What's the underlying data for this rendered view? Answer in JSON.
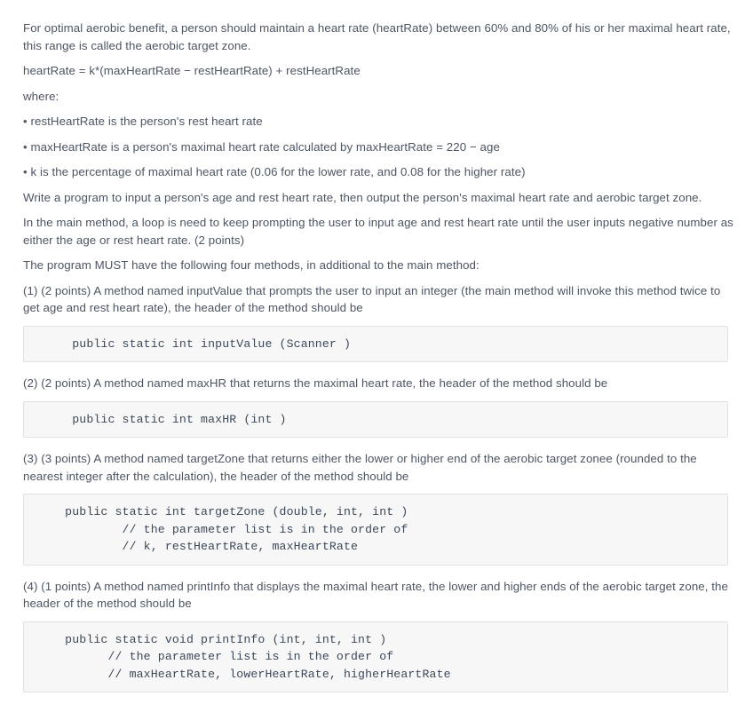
{
  "document": {
    "type": "programming-assignment-prompt",
    "colors": {
      "body_text": "#4d5562",
      "code_text": "#3c4858",
      "code_background": "#f7f7f7",
      "code_border": "#e2e2e2",
      "page_background": "#ffffff"
    },
    "blocks": [
      {
        "kind": "paragraph",
        "name": "intro-paragraph",
        "text": "For optimal aerobic benefit, a person should maintain a heart rate (heartRate) between 60% and 80% of his or her maximal heart rate, this range is called the aerobic target zone."
      },
      {
        "kind": "paragraph",
        "name": "formula-paragraph",
        "text": "heartRate = k*(maxHeartRate − restHeartRate) + restHeartRate"
      },
      {
        "kind": "paragraph",
        "name": "where-label",
        "text": "where:"
      },
      {
        "kind": "paragraph",
        "name": "bullet-rest-heart-rate",
        "text": "• restHeartRate is the person's rest heart rate"
      },
      {
        "kind": "paragraph",
        "name": "bullet-max-heart-rate",
        "text": "• maxHeartRate is a person's maximal heart rate calculated by maxHeartRate = 220 − age"
      },
      {
        "kind": "paragraph",
        "name": "bullet-k-percentage",
        "text": "• k is the percentage of maximal heart rate (0.06 for the lower rate, and 0.08 for the higher rate)"
      },
      {
        "kind": "paragraph",
        "name": "task-paragraph",
        "text": "Write a program to input a person's age and rest heart rate, then output the person's maximal heart rate and aerobic target zone."
      },
      {
        "kind": "paragraph",
        "name": "main-method-requirement",
        "text": "In the main method, a loop is need to keep prompting the user to input age and rest heart rate until the user inputs negative number as either the age or rest heart rate. (2 points)"
      },
      {
        "kind": "paragraph",
        "name": "four-methods-intro",
        "text": "The program MUST have the following four methods, in additional to the main method:"
      },
      {
        "kind": "paragraph",
        "name": "method-1-description",
        "text": "(1) (2 points) A method named inputValue that prompts the user to input an integer (the main method will invoke this method twice to get age and rest heart rate), the header of the method should be"
      },
      {
        "kind": "code",
        "name": "code-block-input-value",
        "text": "     public static int inputValue (Scanner )"
      },
      {
        "kind": "paragraph",
        "name": "method-2-description",
        "text": "(2) (2 points) A method named maxHR that returns the maximal heart rate, the header of the method should be"
      },
      {
        "kind": "code",
        "name": "code-block-max-hr",
        "text": "     public static int maxHR (int )"
      },
      {
        "kind": "paragraph",
        "name": "method-3-description",
        "text": "(3) (3 points) A method named targetZone that returns either the lower or higher end of the aerobic target zonee (rounded to the nearest integer after the calculation), the header of the method should be"
      },
      {
        "kind": "code",
        "name": "code-block-target-zone",
        "text": "    public static int targetZone (double, int, int )\n            // the parameter list is in the order of\n            // k, restHeartRate, maxHeartRate"
      },
      {
        "kind": "paragraph",
        "name": "method-4-description",
        "text": "(4) (1 points) A method named printInfo that displays the maximal heart rate, the lower and higher ends of the aerobic target zone, the header of the method should be"
      },
      {
        "kind": "code",
        "name": "code-block-print-info",
        "text": "    public static void printInfo (int, int, int )\n          // the parameter list is in the order of\n          // maxHeartRate, lowerHeartRate, higherHeartRate"
      }
    ]
  }
}
